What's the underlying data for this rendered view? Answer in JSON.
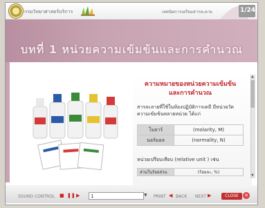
{
  "header": {
    "org_name": "กรมวิทยาศาสตร์บริการ",
    "course_title": "เทคนิคการเตรียมสารละลาย",
    "page_indicator": "1/24"
  },
  "banner": {
    "title": "บทที่ 1 หน่วยความเข้มข้นและการคำนวณ"
  },
  "content": {
    "topic": "ความหมายของหน่วยความเข้มข้น และการคำนวณ",
    "subject": "สารละลายที่ใช้ในห้องปฏิบัติการเคมี มีหน่วยวัดความเข้มข้นหลายหน่วย ได้แก่",
    "units": [
      {
        "name": "โมลาร์",
        "symbol": "(molarity, M)"
      },
      {
        "name": "นอร์มอล",
        "symbol": "(normality, N)"
      }
    ],
    "relative_unit": "หน่วยเปรียบเทียบ (relative unit ) เช่น",
    "relative_rows": [
      {
        "name": "ส่วนในร้อยส่วน",
        "symbol": "(ร้อยละ, %)"
      }
    ]
  },
  "footer": {
    "sound_control": "SOUND CONTROL",
    "page_select": "1",
    "print": "PRINT",
    "back": "BACK",
    "next": "NEXT",
    "close": "CLOSE"
  }
}
